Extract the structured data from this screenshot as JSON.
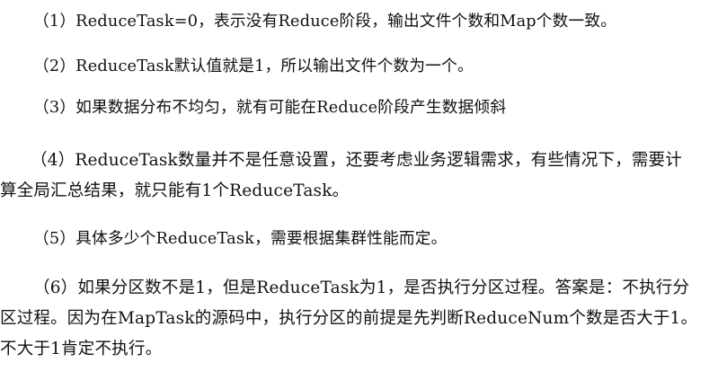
{
  "paragraphs": [
    {
      "lines": [
        "（1）ReduceTask=0，表示没有Reduce阶段，输出文件个数和Map个数一致。"
      ]
    },
    {
      "lines": [
        "（2）ReduceTask默认值就是1，所以输出文件个数为一个。"
      ]
    },
    {
      "lines": [
        "（3）如果数据分布不均匀，就有可能在Reduce阶段产生数据倾斜"
      ]
    },
    {
      "lines": [
        "（4）ReduceTask数量并不是任意设置，还要考虑业务逻辑需求，有些情况下，需要计",
        "算全局汇总结果，就只能有1个ReduceTask。"
      ]
    },
    {
      "lines": [
        "（5）具体多少个ReduceTask，需要根据集群性能而定。"
      ]
    },
    {
      "lines": [
        "（6）如果分区数不是1，但是ReduceTask为1，是否执行分区过程。答案是：不执行分",
        "区过程。因为在MapTask的源码中，执行分区的前提是先判断ReduceNum个数是否大于1。",
        "不大于1肯定不执行。"
      ]
    }
  ]
}
